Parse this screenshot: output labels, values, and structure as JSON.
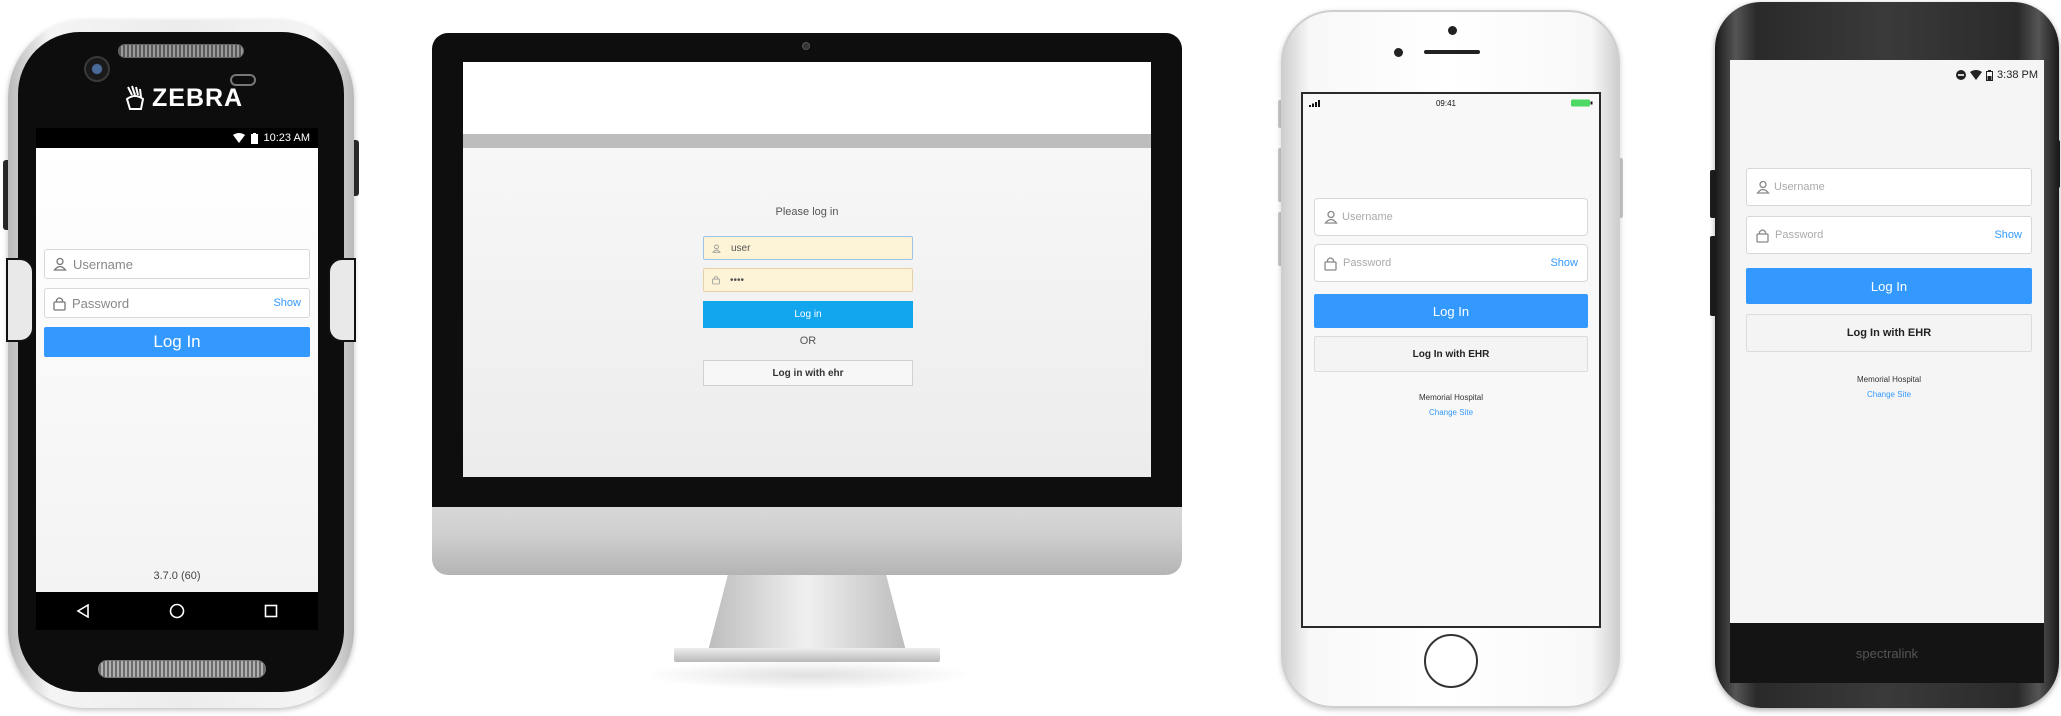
{
  "zebra": {
    "brand": "ZEBRA",
    "time": "10:23 AM",
    "username_placeholder": "Username",
    "password_placeholder": "Password",
    "show_label": "Show",
    "login_label": "Log In",
    "version": "3.7.0 (60)"
  },
  "desktop": {
    "prompt": "Please log in",
    "username_value": "user",
    "password_value": "••••",
    "login_label": "Log in",
    "or_label": "OR",
    "ehr_label": "Log in with ehr"
  },
  "iphone": {
    "time": "09:41",
    "username_placeholder": "Username",
    "password_placeholder": "Password",
    "show_label": "Show",
    "login_label": "Log In",
    "ehr_label": "Log In with EHR",
    "site_name": "Memorial Hospital",
    "change_site_label": "Change Site"
  },
  "spectralink": {
    "time": "3:38 PM",
    "username_placeholder": "Username",
    "password_placeholder": "Password",
    "show_label": "Show",
    "login_label": "Log In",
    "ehr_label": "Log In with EHR",
    "site_name": "Memorial Hospital",
    "change_site_label": "Change Site",
    "brand": "spectralink"
  },
  "colors": {
    "accent_blue": "#3399ff",
    "web_button_blue": "#12a6ee",
    "autofill_yellow": "#fdf3d6"
  },
  "icons": [
    "user-icon",
    "lock-icon",
    "wifi-icon",
    "battery-icon",
    "signal-icon",
    "back-icon",
    "home-icon",
    "recents-icon",
    "camera-icon",
    "dnd-icon"
  ]
}
